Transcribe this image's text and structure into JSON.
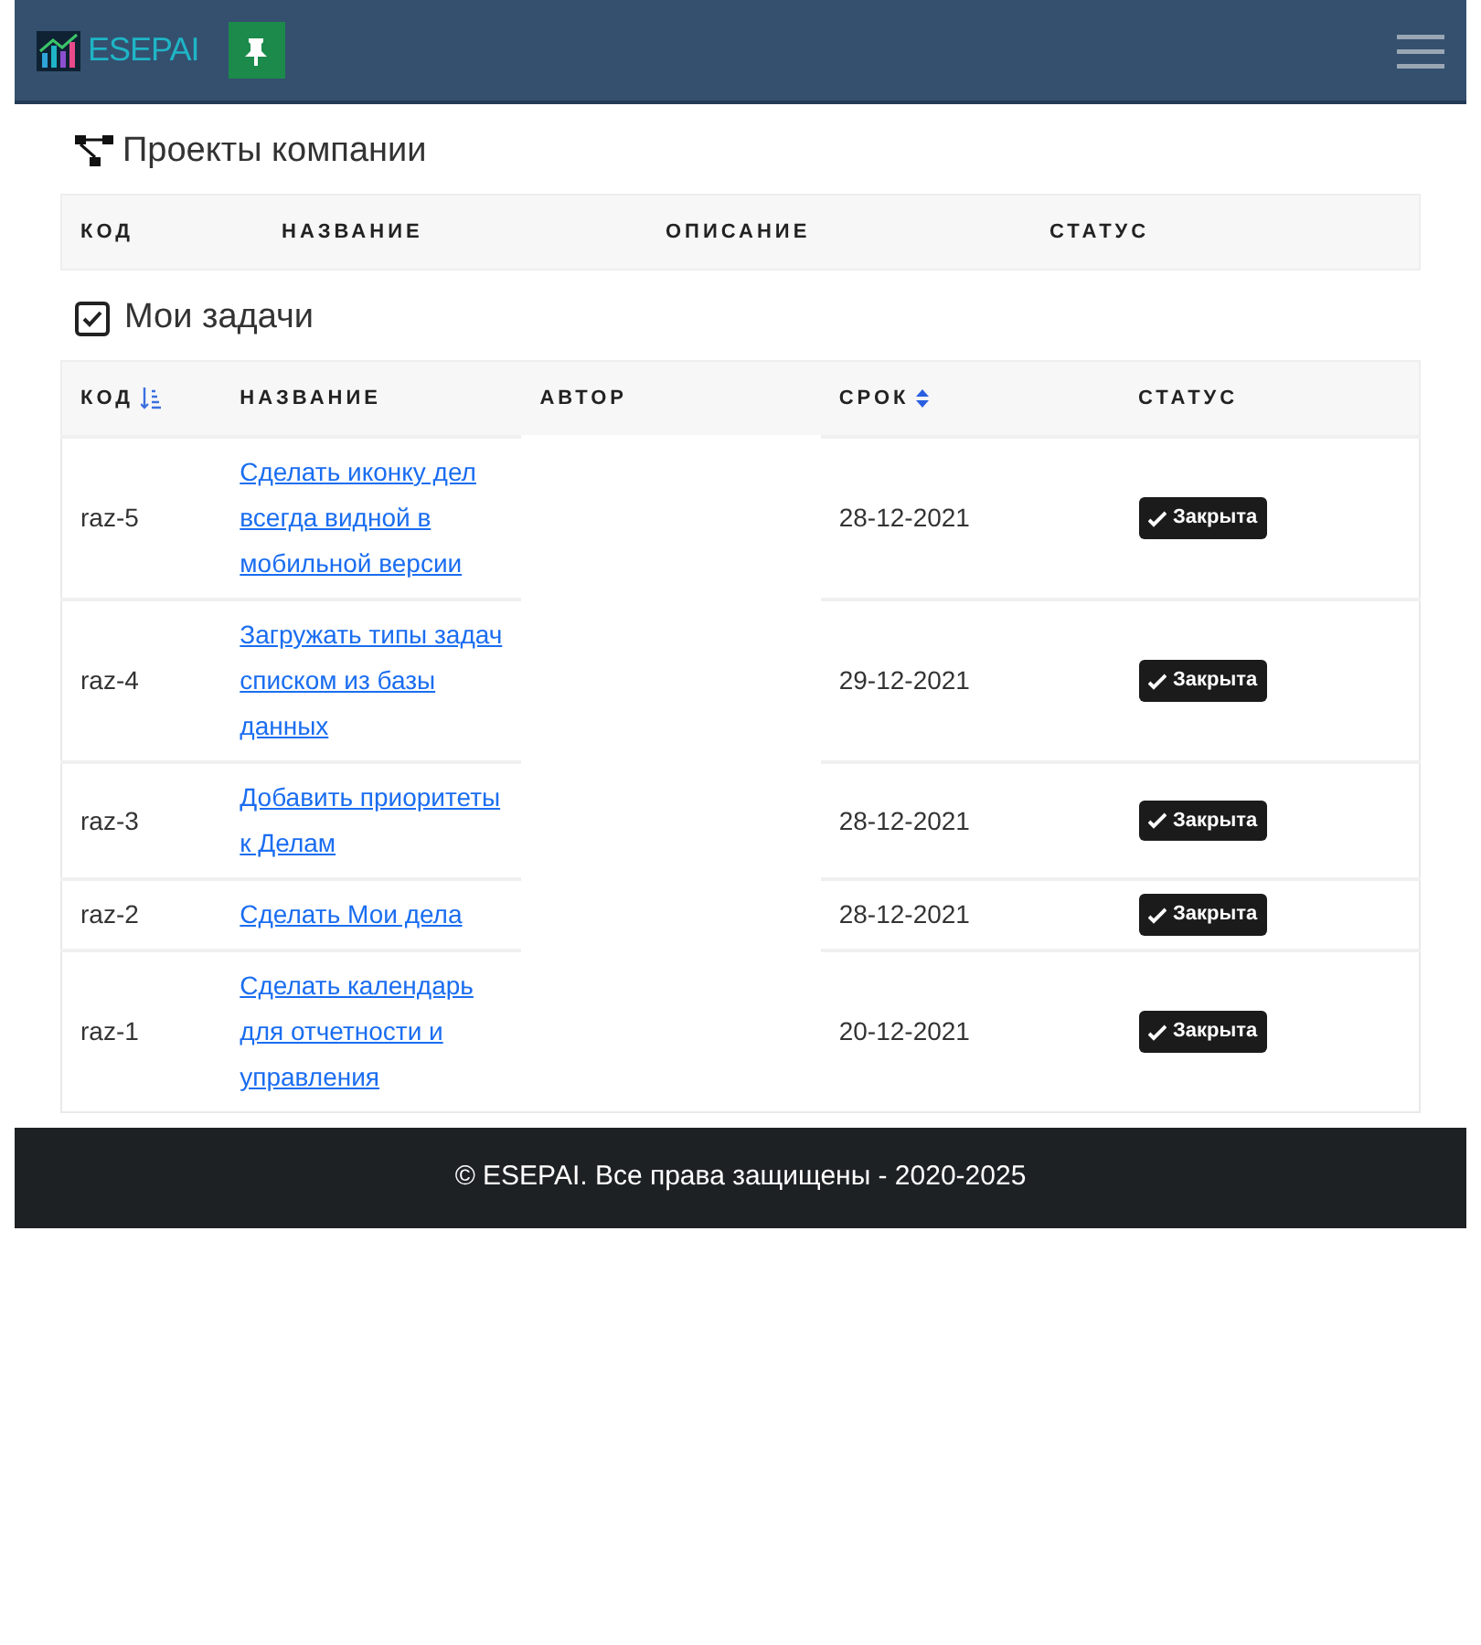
{
  "navbar": {
    "brand": "ESEPAI"
  },
  "projects": {
    "title": "Проекты компании",
    "columns": [
      {
        "label": "КОД"
      },
      {
        "label": "НАЗВАНИЕ"
      },
      {
        "label": "ОПИСАНИЕ"
      },
      {
        "label": "СТАТУС"
      }
    ]
  },
  "tasks": {
    "title": "Мои задачи",
    "columns": [
      {
        "label": "КОД",
        "kind": "sorted"
      },
      {
        "label": "НАЗВАНИЕ",
        "kind": "plain"
      },
      {
        "label": "АВТОР",
        "kind": "plain"
      },
      {
        "label": "СРОК",
        "kind": "sortable"
      },
      {
        "label": "СТАТУС",
        "kind": "plain"
      }
    ],
    "rows": [
      {
        "code": "raz-5",
        "name": "Сделать иконку дел всегда видной в мобильной версии",
        "date": "28-12-2021",
        "status": "Закрыта"
      },
      {
        "code": "raz-4",
        "name": "Загружать типы задач списком из базы данных",
        "date": "29-12-2021",
        "status": "Закрыта"
      },
      {
        "code": "raz-3",
        "name": "Добавить приоритеты к Делам",
        "date": "28-12-2021",
        "status": "Закрыта"
      },
      {
        "code": "raz-2",
        "name": "Сделать Мои дела",
        "date": "28-12-2021",
        "status": "Закрыта"
      },
      {
        "code": "raz-1",
        "name": "Сделать календарь для отчетности и управления",
        "date": "20-12-2021",
        "status": "Закрыта"
      }
    ]
  },
  "footer": {
    "text": "© ESEPAI. Все права защищены - 2020-2025"
  }
}
